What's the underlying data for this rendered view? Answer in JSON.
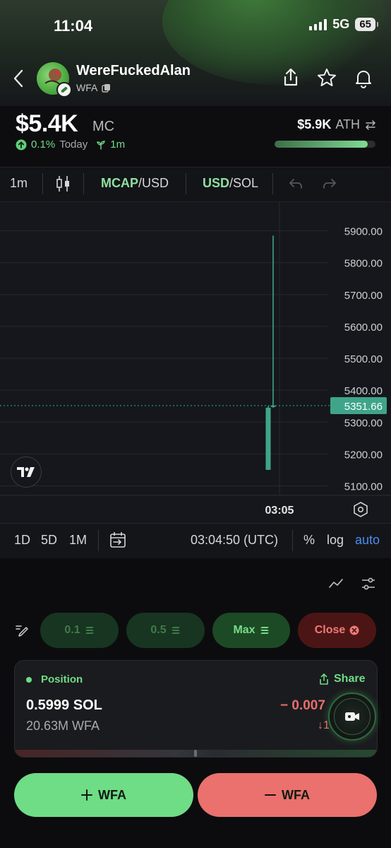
{
  "status_bar": {
    "time": "11:04",
    "network": "5G",
    "battery": "65"
  },
  "token": {
    "name": "WereFuckedAlan",
    "symbol": "WFA"
  },
  "market": {
    "mc_value": "$5.4K",
    "mc_label": "MC",
    "change": "0.1%",
    "change_period": "Today",
    "age": "1m",
    "ath_value": "$5.9K",
    "ath_label": "ATH",
    "ath_progress": 0.92
  },
  "toolbar": {
    "interval": "1m",
    "mcap_label": "MCAP",
    "mcap_suffix": "/USD",
    "usd_label": "USD",
    "usd_suffix": "/SOL"
  },
  "chart_data": {
    "type": "candlestick",
    "y_ticks": [
      "5900.00",
      "5800.00",
      "5700.00",
      "5600.00",
      "5500.00",
      "5400.00",
      "5300.00",
      "5200.00",
      "5100.00"
    ],
    "ylim": [
      5070,
      5990
    ],
    "x_label": "03:05",
    "current_price": "5351.66",
    "candles": [
      {
        "open": 5150,
        "high": 5350,
        "low": 5150,
        "close": 5345
      },
      {
        "open": 5350,
        "high": 5885,
        "low": 5345,
        "close": 5352
      }
    ],
    "colors": {
      "up": "#3fa58a",
      "price_tag": "#3fa58a"
    }
  },
  "chart_footer": {
    "ranges": [
      "1D",
      "5D",
      "1M"
    ],
    "time": "03:04:50 (UTC)",
    "percent": "%",
    "log": "log",
    "auto": "auto"
  },
  "quick_buttons": {
    "b1": "0.1",
    "b2": "0.5",
    "max": "Max",
    "close": "Close"
  },
  "position": {
    "label": "Position",
    "share": "Share",
    "sol": "0.5999 SOL",
    "tokens": "20.63M WFA",
    "pnl": "− 0.007",
    "pnl_sub": "↓1"
  },
  "actions": {
    "buy": "WFA",
    "sell": "WFA"
  },
  "colors": {
    "accent_green": "#6fdc86",
    "danger_red": "#e86e6a",
    "teal": "#3fa58a"
  }
}
